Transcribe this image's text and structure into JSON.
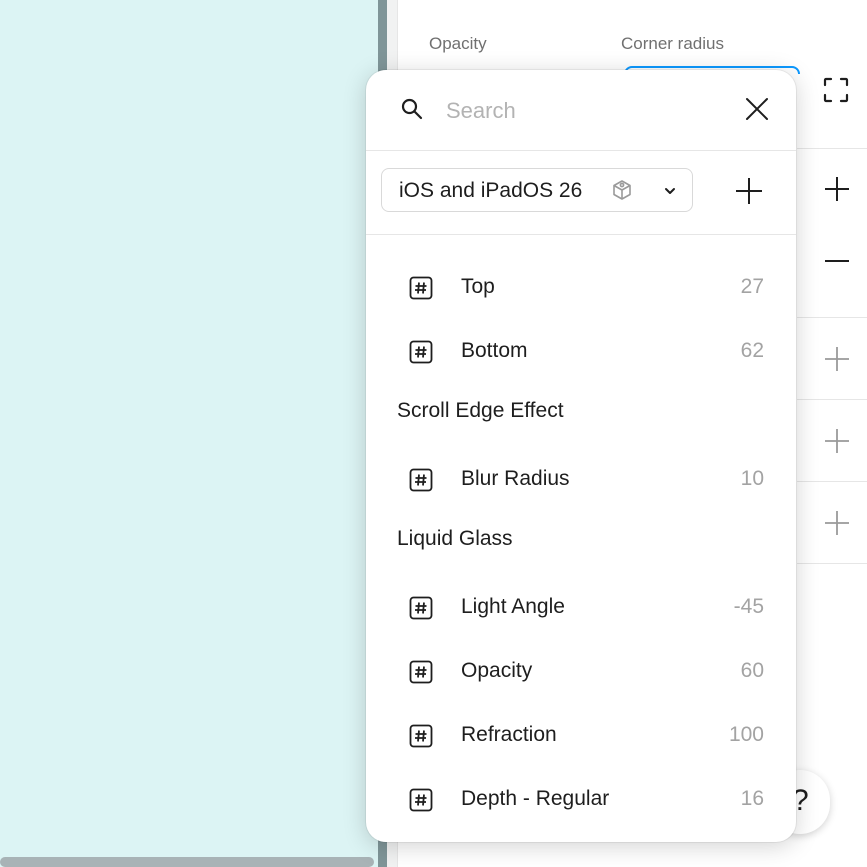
{
  "panel": {
    "opacity_label": "Opacity",
    "corner_radius_label": "Corner radius"
  },
  "help": {
    "label": "?"
  },
  "popover": {
    "search": {
      "placeholder": "Search",
      "value": ""
    },
    "library": {
      "selected": "iOS and iPadOS 26"
    },
    "rows": [
      {
        "kind": "var",
        "name": "Top",
        "value": "27"
      },
      {
        "kind": "var",
        "name": "Bottom",
        "value": "62"
      },
      {
        "kind": "group",
        "name": "Scroll Edge Effect"
      },
      {
        "kind": "var",
        "name": "Blur Radius",
        "value": "10"
      },
      {
        "kind": "group",
        "name": "Liquid Glass"
      },
      {
        "kind": "var",
        "name": "Light Angle",
        "value": "-45"
      },
      {
        "kind": "var",
        "name": "Opacity",
        "value": "60"
      },
      {
        "kind": "var",
        "name": "Refraction",
        "value": "100"
      },
      {
        "kind": "var",
        "name": "Depth - Regular",
        "value": "16"
      }
    ]
  },
  "icons": {
    "search": "search-icon",
    "close": "close-icon",
    "library": "library-icon",
    "chevron": "chevron-down-icon",
    "add": "plus-icon",
    "number": "number-variable-icon"
  },
  "colors": {
    "canvas": "#dcf4f4",
    "accent": "#0d99ff",
    "muted_text": "#a3a3a3"
  }
}
